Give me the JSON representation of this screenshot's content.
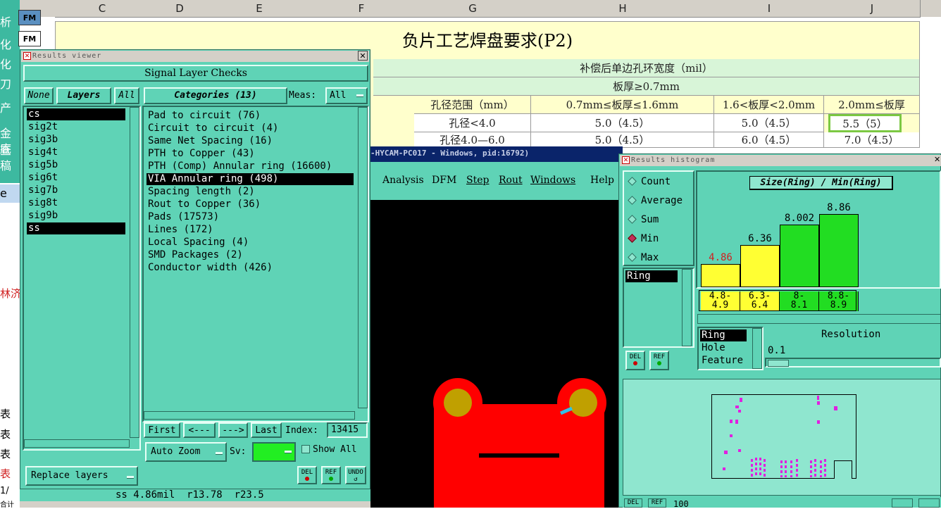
{
  "spreadsheet": {
    "column_headers": [
      "C",
      "D",
      "E",
      "F",
      "G",
      "H",
      "I",
      "J"
    ],
    "left_tabs": [
      "FM",
      "FM"
    ],
    "left_chars": [
      "析",
      "化",
      "化",
      "刀",
      "产",
      "金查",
      "底稿"
    ],
    "title": "负片工艺焊盘要求(P2)",
    "subheader": "补偿后单边孔环宽度（mil）",
    "board_thickness": "板厚≥0.7mm",
    "row_headers": [
      "孔径范围（mm）",
      "0.7mm≤板厚≤1.6mm",
      "1.6<板厚<2.0mm",
      "2.0mm≤板厚"
    ],
    "row1": [
      "孔径<4.0",
      "5.0（4.5）",
      "5.0（4.5）",
      "5.5（5）"
    ],
    "row2": [
      "孔径4.0—6.0",
      "5.0（4.5）",
      "6.0（4.5）",
      "7.0（4.5）"
    ],
    "left_fragments": [
      "e",
      "林济",
      "表",
      "表",
      "表",
      "表",
      "1/",
      "合计"
    ]
  },
  "results_viewer": {
    "window_title": "Results viewer",
    "header": "Signal Layer Checks",
    "layers_buttons": {
      "none": "None",
      "layers": "Layers",
      "all": "All"
    },
    "layers": [
      "cs",
      "sig2t",
      "sig3b",
      "sig4t",
      "sig5b",
      "sig6t",
      "sig7b",
      "sig8t",
      "sig9b",
      "ss"
    ],
    "categories_label": "Categories (13)",
    "meas_label": "Meas:",
    "meas_value": "All",
    "categories": [
      "Pad to circuit (76)",
      "Circuit to circuit (4)",
      "Same Net Spacing (16)",
      "PTH to Copper (43)",
      "PTH (Comp) Annular ring (16600)",
      "VIA Annular ring (498)",
      "Spacing length (2)",
      "Rout to Copper (36)",
      "Pads (17573)",
      "Lines (172)",
      "Local Spacing (4)",
      "SMD Packages (2)",
      "Conductor width (426)"
    ],
    "nav": {
      "first": "First",
      "prev": "<---",
      "next": "--->",
      "last": "Last",
      "index_label": "Index:",
      "index_value": "13415"
    },
    "auto_zoom": "Auto Zoom",
    "sv_label": "Sv:",
    "show_all": "Show All",
    "replace_layers": "Replace layers",
    "icon_buttons": [
      "DEL",
      "REF",
      "UNDO"
    ],
    "status": "ss 4.86mil  r13.78  r23.5"
  },
  "cam_window": {
    "title": "-HYCAM-PC017 - Windows, pid:16792)",
    "menu": [
      "Analysis",
      "DFM",
      "Step",
      "Rout",
      "Windows",
      "Help"
    ]
  },
  "histogram": {
    "window_title": "Results histogram",
    "modes": [
      "Count",
      "Average",
      "Sum",
      "Min",
      "Max"
    ],
    "selected_mode": "Min",
    "chart_title": "Size(Ring) / Min(Ring)",
    "list_items": [
      "Ring"
    ],
    "feature_items": [
      "Ring",
      "Hole",
      "Feature"
    ],
    "resolution_label": "Resolution",
    "resolution_value": "0.1",
    "bottom_text": "100",
    "chart_data": {
      "type": "bar",
      "categories": [
        "4.8-4.9",
        "6.3-6.4",
        "8-8.1",
        "8.8-8.9"
      ],
      "values": [
        4.86,
        6.36,
        8.002,
        8.86
      ],
      "value_labels": [
        "4.86",
        "6.36",
        "8.002",
        "8.86"
      ],
      "colors": [
        "#ffff33",
        "#ffff33",
        "#22dd22",
        "#22dd22"
      ],
      "title": "Size(Ring) / Min(Ring)",
      "ylim": [
        0,
        10
      ]
    }
  }
}
